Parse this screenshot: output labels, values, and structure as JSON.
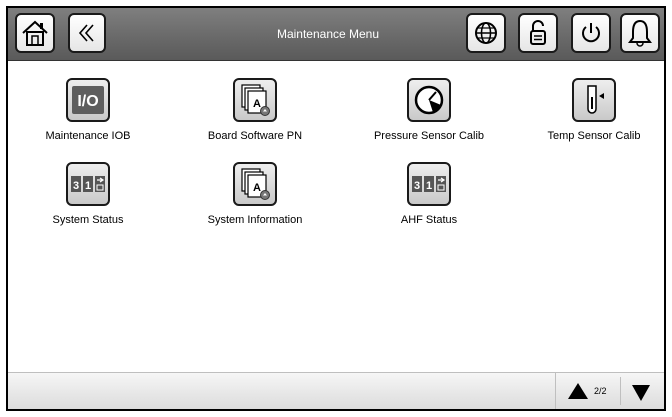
{
  "header": {
    "title": "Maintenance Menu",
    "buttons": [
      {
        "icon": "home-icon"
      },
      {
        "icon": "back-icon"
      },
      {
        "icon": "globe-icon"
      },
      {
        "icon": "lock-icon"
      },
      {
        "icon": "power-icon"
      },
      {
        "icon": "alarm-bell-icon"
      }
    ]
  },
  "tiles": [
    {
      "label": "Maintenance IOB",
      "icon": "io-icon"
    },
    {
      "label": "Board Software PN",
      "icon": "document-stack-icon"
    },
    {
      "label": "Pressure Sensor Calib",
      "icon": "gauge-icon"
    },
    {
      "label": "Temp Sensor Calib",
      "icon": "thermometer-icon"
    },
    {
      "label": "System Status",
      "icon": "calendar-counter-icon"
    },
    {
      "label": "System Information",
      "icon": "document-stack-icon"
    },
    {
      "label": "AHF Status",
      "icon": "calendar-counter-icon"
    }
  ],
  "pager": {
    "page": "2/2"
  },
  "colors": {
    "header": "#6f6f6f",
    "tile_bg": "#d9d9d9",
    "io_badge": "#666666"
  }
}
